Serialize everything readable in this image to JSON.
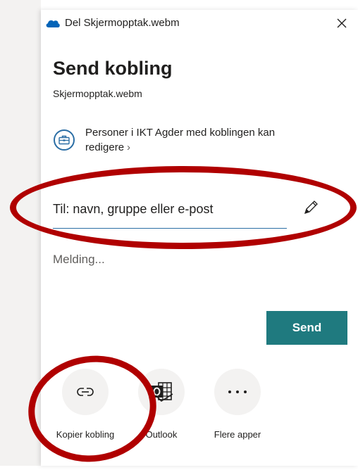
{
  "window": {
    "title": "Del Skjermopptak.webm"
  },
  "share": {
    "heading": "Send kobling",
    "filename": "Skjermopptak.webm",
    "permission_text": "Personer i IKT Agder med koblingen kan redigere",
    "permission_chevron": "›"
  },
  "to_field": {
    "placeholder": "Til: navn, gruppe eller e-post"
  },
  "message_field": {
    "placeholder": "Melding..."
  },
  "send_button": {
    "label": "Send"
  },
  "apps": [
    {
      "label": "Kopier kobling",
      "icon": "link-icon"
    },
    {
      "label": "Outlook",
      "icon": "outlook-icon"
    },
    {
      "label": "Flere apper",
      "icon": "more-icon"
    }
  ],
  "colors": {
    "accent": "#1f7a7f",
    "annotation": "#b00000",
    "link_blue": "#2b6ea5"
  }
}
